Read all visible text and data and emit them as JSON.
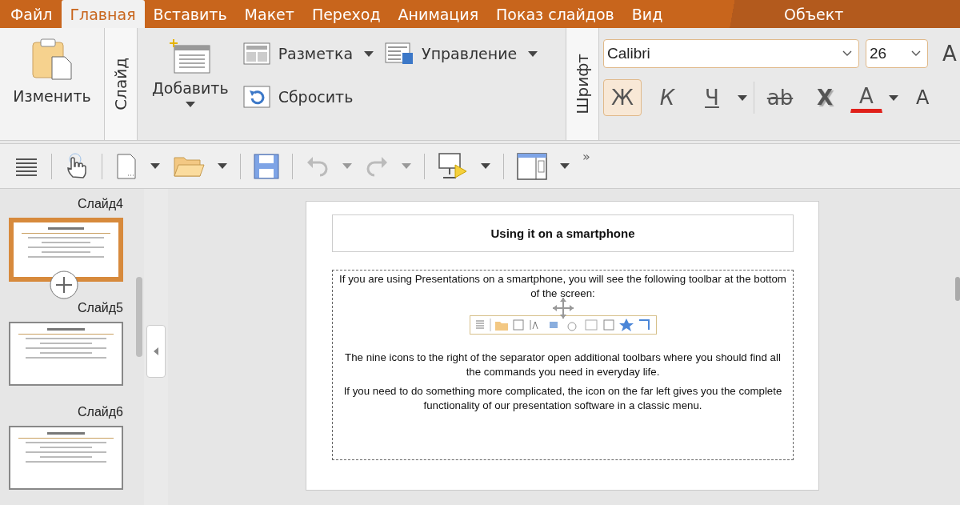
{
  "menu_tabs": [
    {
      "label": "Файл",
      "selected": false
    },
    {
      "label": "Главная",
      "selected": true
    },
    {
      "label": "Вставить",
      "selected": false
    },
    {
      "label": "Макет",
      "selected": false
    },
    {
      "label": "Переход",
      "selected": false
    },
    {
      "label": "Анимация",
      "selected": false
    },
    {
      "label": "Показ слайдов",
      "selected": false
    },
    {
      "label": "Вид",
      "selected": false
    }
  ],
  "context_tab": {
    "label": "Объект"
  },
  "ribbon": {
    "edit_button": "Изменить",
    "slide_group": {
      "label": "Слайд",
      "add_button": "Добавить",
      "layout_button": "Разметка",
      "manage_button": "Управление",
      "reset_button": "Сбросить"
    },
    "font_group": {
      "label": "Шрифт",
      "font": "Calibri",
      "size": "26",
      "grow_button": "A",
      "case_button": "A",
      "format_buttons": [
        {
          "kind": "bold",
          "label": "Ж",
          "selected": true
        },
        {
          "kind": "italic",
          "label": "К",
          "selected": false
        },
        {
          "kind": "underline",
          "label": "Ч",
          "selected": false
        },
        {
          "kind": "strike",
          "label": "ab",
          "selected": false
        },
        {
          "kind": "shadow",
          "label": "X",
          "selected": false
        },
        {
          "kind": "color",
          "label": "A",
          "selected": false,
          "color": "#e0201a"
        }
      ]
    }
  },
  "toolbar": {
    "overflow": "»"
  },
  "slides": [
    {
      "label": "Слайд4",
      "selected": true
    },
    {
      "label": "Слайд5",
      "selected": false
    },
    {
      "label": "Слайд6",
      "selected": false
    }
  ],
  "slide": {
    "title": "Using it on a smartphone",
    "paragraphs": [
      "If you are using Presentations on a smartphone, you will see the following toolbar at the bottom of the screen:",
      "The nine icons to the right of the separator open additional toolbars where you should find all the commands you need in everyday life.",
      "If you need to do something more complicated, the icon on the far left gives you the complete functionality of our presentation software in a classic menu."
    ]
  }
}
